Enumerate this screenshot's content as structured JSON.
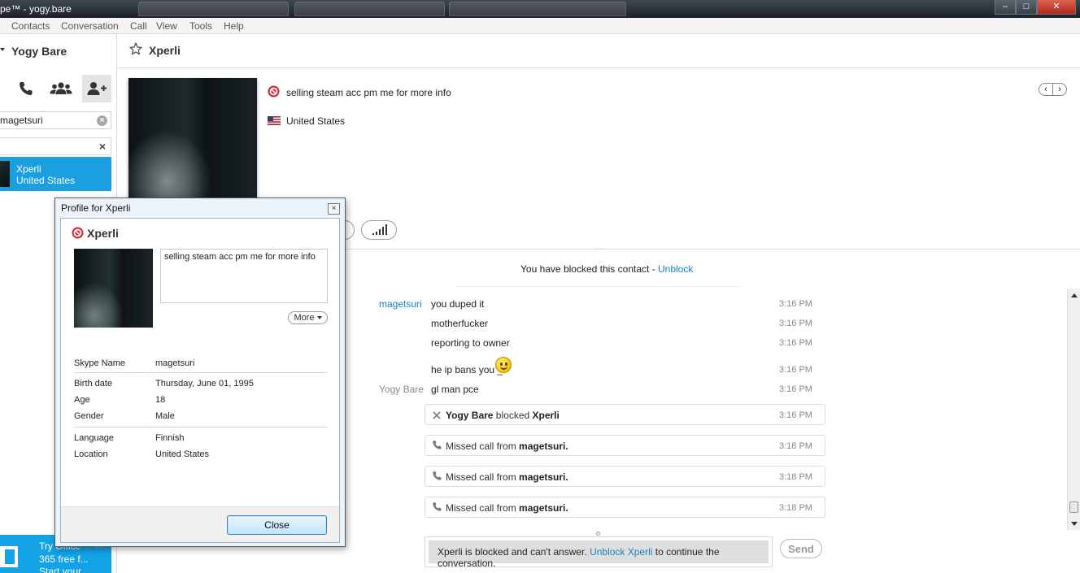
{
  "window": {
    "title": "pe™ - yogy.bare",
    "minimize": "–",
    "maximize": "□",
    "close": "✕"
  },
  "menu": [
    "Contacts",
    "Conversation",
    "Call",
    "View",
    "Tools",
    "Help"
  ],
  "sidebar": {
    "user_name": "Yogy Bare",
    "search_value": "magetsuri",
    "clear_glyph": "×",
    "results_close": "×",
    "contact": {
      "name": "Xperli",
      "location": "United States"
    },
    "ad": {
      "line1": "Try Office",
      "line2": "365 free f...",
      "line3": "Start your",
      "close": "×"
    }
  },
  "conversation": {
    "title": "Xperli",
    "mood": "selling steam acc pm me for more info",
    "country": "United States",
    "more_dots": "...",
    "blocked_notice": "You have blocked this contact - ",
    "unblock_link": "Unblock",
    "messages": [
      {
        "sender": "magetsuri",
        "text": "you duped it",
        "time": "3:16 PM"
      },
      {
        "sender": "",
        "text": "motherfucker",
        "time": "3:16 PM"
      },
      {
        "sender": "",
        "text": "reporting to owner",
        "time": "3:16 PM"
      },
      {
        "sender": "",
        "text": "he ip bans you _",
        "time": "3:16 PM"
      },
      {
        "sender": "Yogy Bare",
        "text": "gl man pce",
        "time": "3:16 PM"
      }
    ],
    "events": [
      {
        "actor": "Yogy Bare",
        "action": " blocked ",
        "target": "Xperli",
        "time": "3:16 PM"
      },
      {
        "prefix": "Missed call from ",
        "who": "magetsuri.",
        "time": "3:18 PM"
      },
      {
        "prefix": "Missed call from ",
        "who": "magetsuri.",
        "time": "3:18 PM"
      },
      {
        "prefix": "Missed call from ",
        "who": "magetsuri.",
        "time": "3:18 PM"
      }
    ],
    "composer": {
      "blocked_msg": "Xperli is blocked and can't answer. ",
      "unblock_link": "Unblock Xperli",
      "blocked_msg_end": " to continue the conversation.",
      "send": "Send"
    },
    "nav_prev": "‹",
    "nav_next": "›"
  },
  "profile_dialog": {
    "title": "Profile for Xperli",
    "close_x": "×",
    "name": "Xperli",
    "mood": "selling steam acc pm me for more info",
    "more": "More",
    "fields": {
      "skype_name_label": "Skype Name",
      "skype_name": "magetsuri",
      "birth_date_label": "Birth date",
      "birth_date": "Thursday, June 01, 1995",
      "age_label": "Age",
      "age": "18",
      "gender_label": "Gender",
      "gender": "Male",
      "language_label": "Language",
      "language": "Finnish",
      "location_label": "Location",
      "location": "United States"
    },
    "close_button": "Close"
  },
  "colors": {
    "accent": "#1aa0e0",
    "link": "#1a7fc2",
    "skype_red": "#e0242f"
  }
}
